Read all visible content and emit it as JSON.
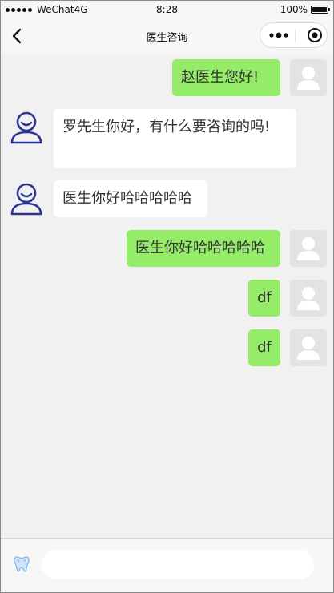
{
  "status_bar": {
    "carrier": "WeChat4G",
    "time": "8:28",
    "battery": "100%",
    "battery_level": 1.0
  },
  "navbar": {
    "title": "医生咨询",
    "icons": [
      "back-arrow-icon",
      "more-dots-icon",
      "target-home-icon"
    ]
  },
  "messages": [
    {
      "from": "user",
      "text": "赵医生您好!"
    },
    {
      "from": "doctor",
      "text": "罗先生你好，有什么要咨询的吗!"
    },
    {
      "from": "doctor",
      "text": "医生你好哈哈哈哈哈"
    },
    {
      "from": "user",
      "text": "医生你好哈哈哈哈哈"
    },
    {
      "from": "user",
      "text": "df"
    },
    {
      "from": "user",
      "text": "df"
    }
  ],
  "composer": {
    "icon": "tooth-icon",
    "placeholder": "",
    "value": ""
  },
  "colors": {
    "user_bubble": "#95ec69",
    "doctor_bubble": "#ffffff",
    "doctor_avatar_stroke": "#2a3596",
    "background": "#f1f1f1"
  }
}
